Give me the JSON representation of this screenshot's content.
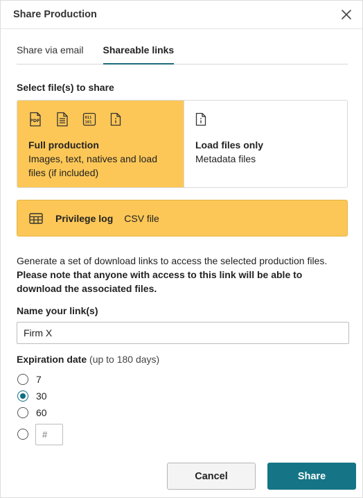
{
  "dialog": {
    "title": "Share Production"
  },
  "tabs": [
    {
      "label": "Share via email",
      "active": false
    },
    {
      "label": "Shareable links",
      "active": true
    }
  ],
  "files": {
    "label": "Select file(s) to share",
    "full": {
      "title": "Full production",
      "desc": "Images, text, natives and load files (if included)",
      "icons": [
        "pdf-icon",
        "document-icon",
        "binary-icon",
        "info-file-icon"
      ]
    },
    "load": {
      "title": "Load files only",
      "desc": "Metadata files",
      "icons": [
        "info-file-icon"
      ]
    },
    "privilege": {
      "title": "Privilege log",
      "desc": "CSV file",
      "icon": "table-icon"
    }
  },
  "note": {
    "text": "Generate a set of download links to access the selected production files.",
    "bold": "Please note that anyone with access to this link will be able to download the associated files."
  },
  "link_name": {
    "label": "Name your link(s)",
    "value": "Firm X"
  },
  "expiration": {
    "label": "Expiration date",
    "hint": "(up to 180 days)",
    "options": [
      {
        "label": "7",
        "checked": false
      },
      {
        "label": "30",
        "checked": true
      },
      {
        "label": "60",
        "checked": false
      }
    ],
    "custom_placeholder": "#"
  },
  "buttons": {
    "cancel": "Cancel",
    "share": "Share"
  },
  "colors": {
    "accent": "#157486",
    "selected_card": "#fcc757"
  }
}
